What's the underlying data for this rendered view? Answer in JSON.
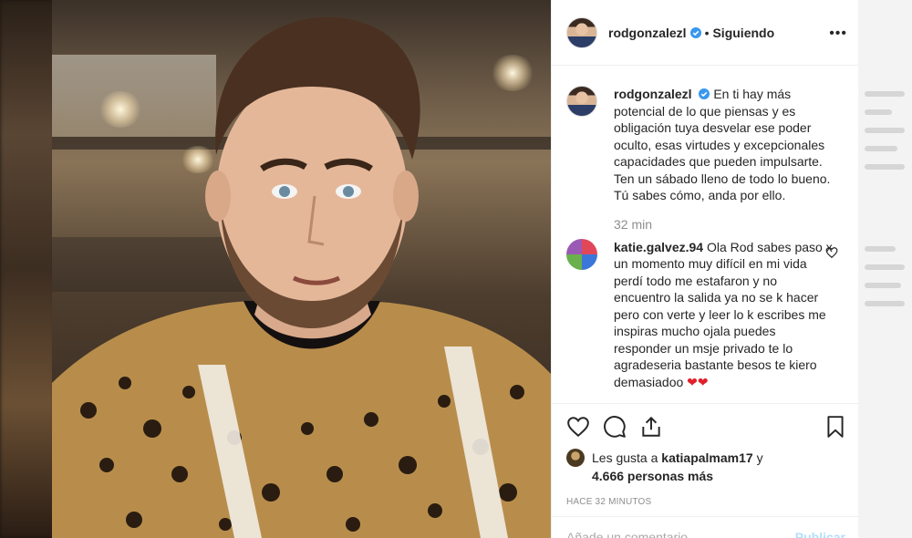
{
  "post": {
    "username": "rodgonzalezl",
    "follow_state": "Siguiendo",
    "more_label": "•••",
    "separator": "•"
  },
  "caption": {
    "username": "rodgonzalezl",
    "text": "En ti hay más potencial de lo que piensas y es obligación tuya desvelar ese poder oculto, esas virtudes y excepcionales capacidades que pueden impulsarte. Ten un sábado lleno de todo lo bueno. Tú sabes cómo, anda por ello.",
    "time": "32 min"
  },
  "comments": [
    {
      "username": "katie.galvez.94",
      "text": "Ola Rod sabes paso x un momento muy difícil en mi vida perdí todo me estafaron y no encuentro la salida ya no se k hacer pero con verte y leer lo k escribes me inspiras mucho ojala puedes responder un msje privado te lo agradeseria bastante besos te kiero demasiadoo",
      "emoji": "❤❤"
    }
  ],
  "likes": {
    "prefix": "Les gusta a",
    "user": "katiapalmam17",
    "suffix": "y",
    "others": "4.666 personas más"
  },
  "timestamp": "HACE 32 MINUTOS",
  "add_comment": {
    "placeholder": "Añade un comentario...",
    "publish": "Publicar"
  },
  "icons": {
    "verified": "verified-badge-icon",
    "like": "heart-icon",
    "comment": "comment-bubble-icon",
    "share": "share-icon",
    "save": "bookmark-icon"
  },
  "colors": {
    "verified": "#3897f0",
    "text": "#262626",
    "muted": "#8e8e8e",
    "emoji_heart": "#e0202c"
  }
}
